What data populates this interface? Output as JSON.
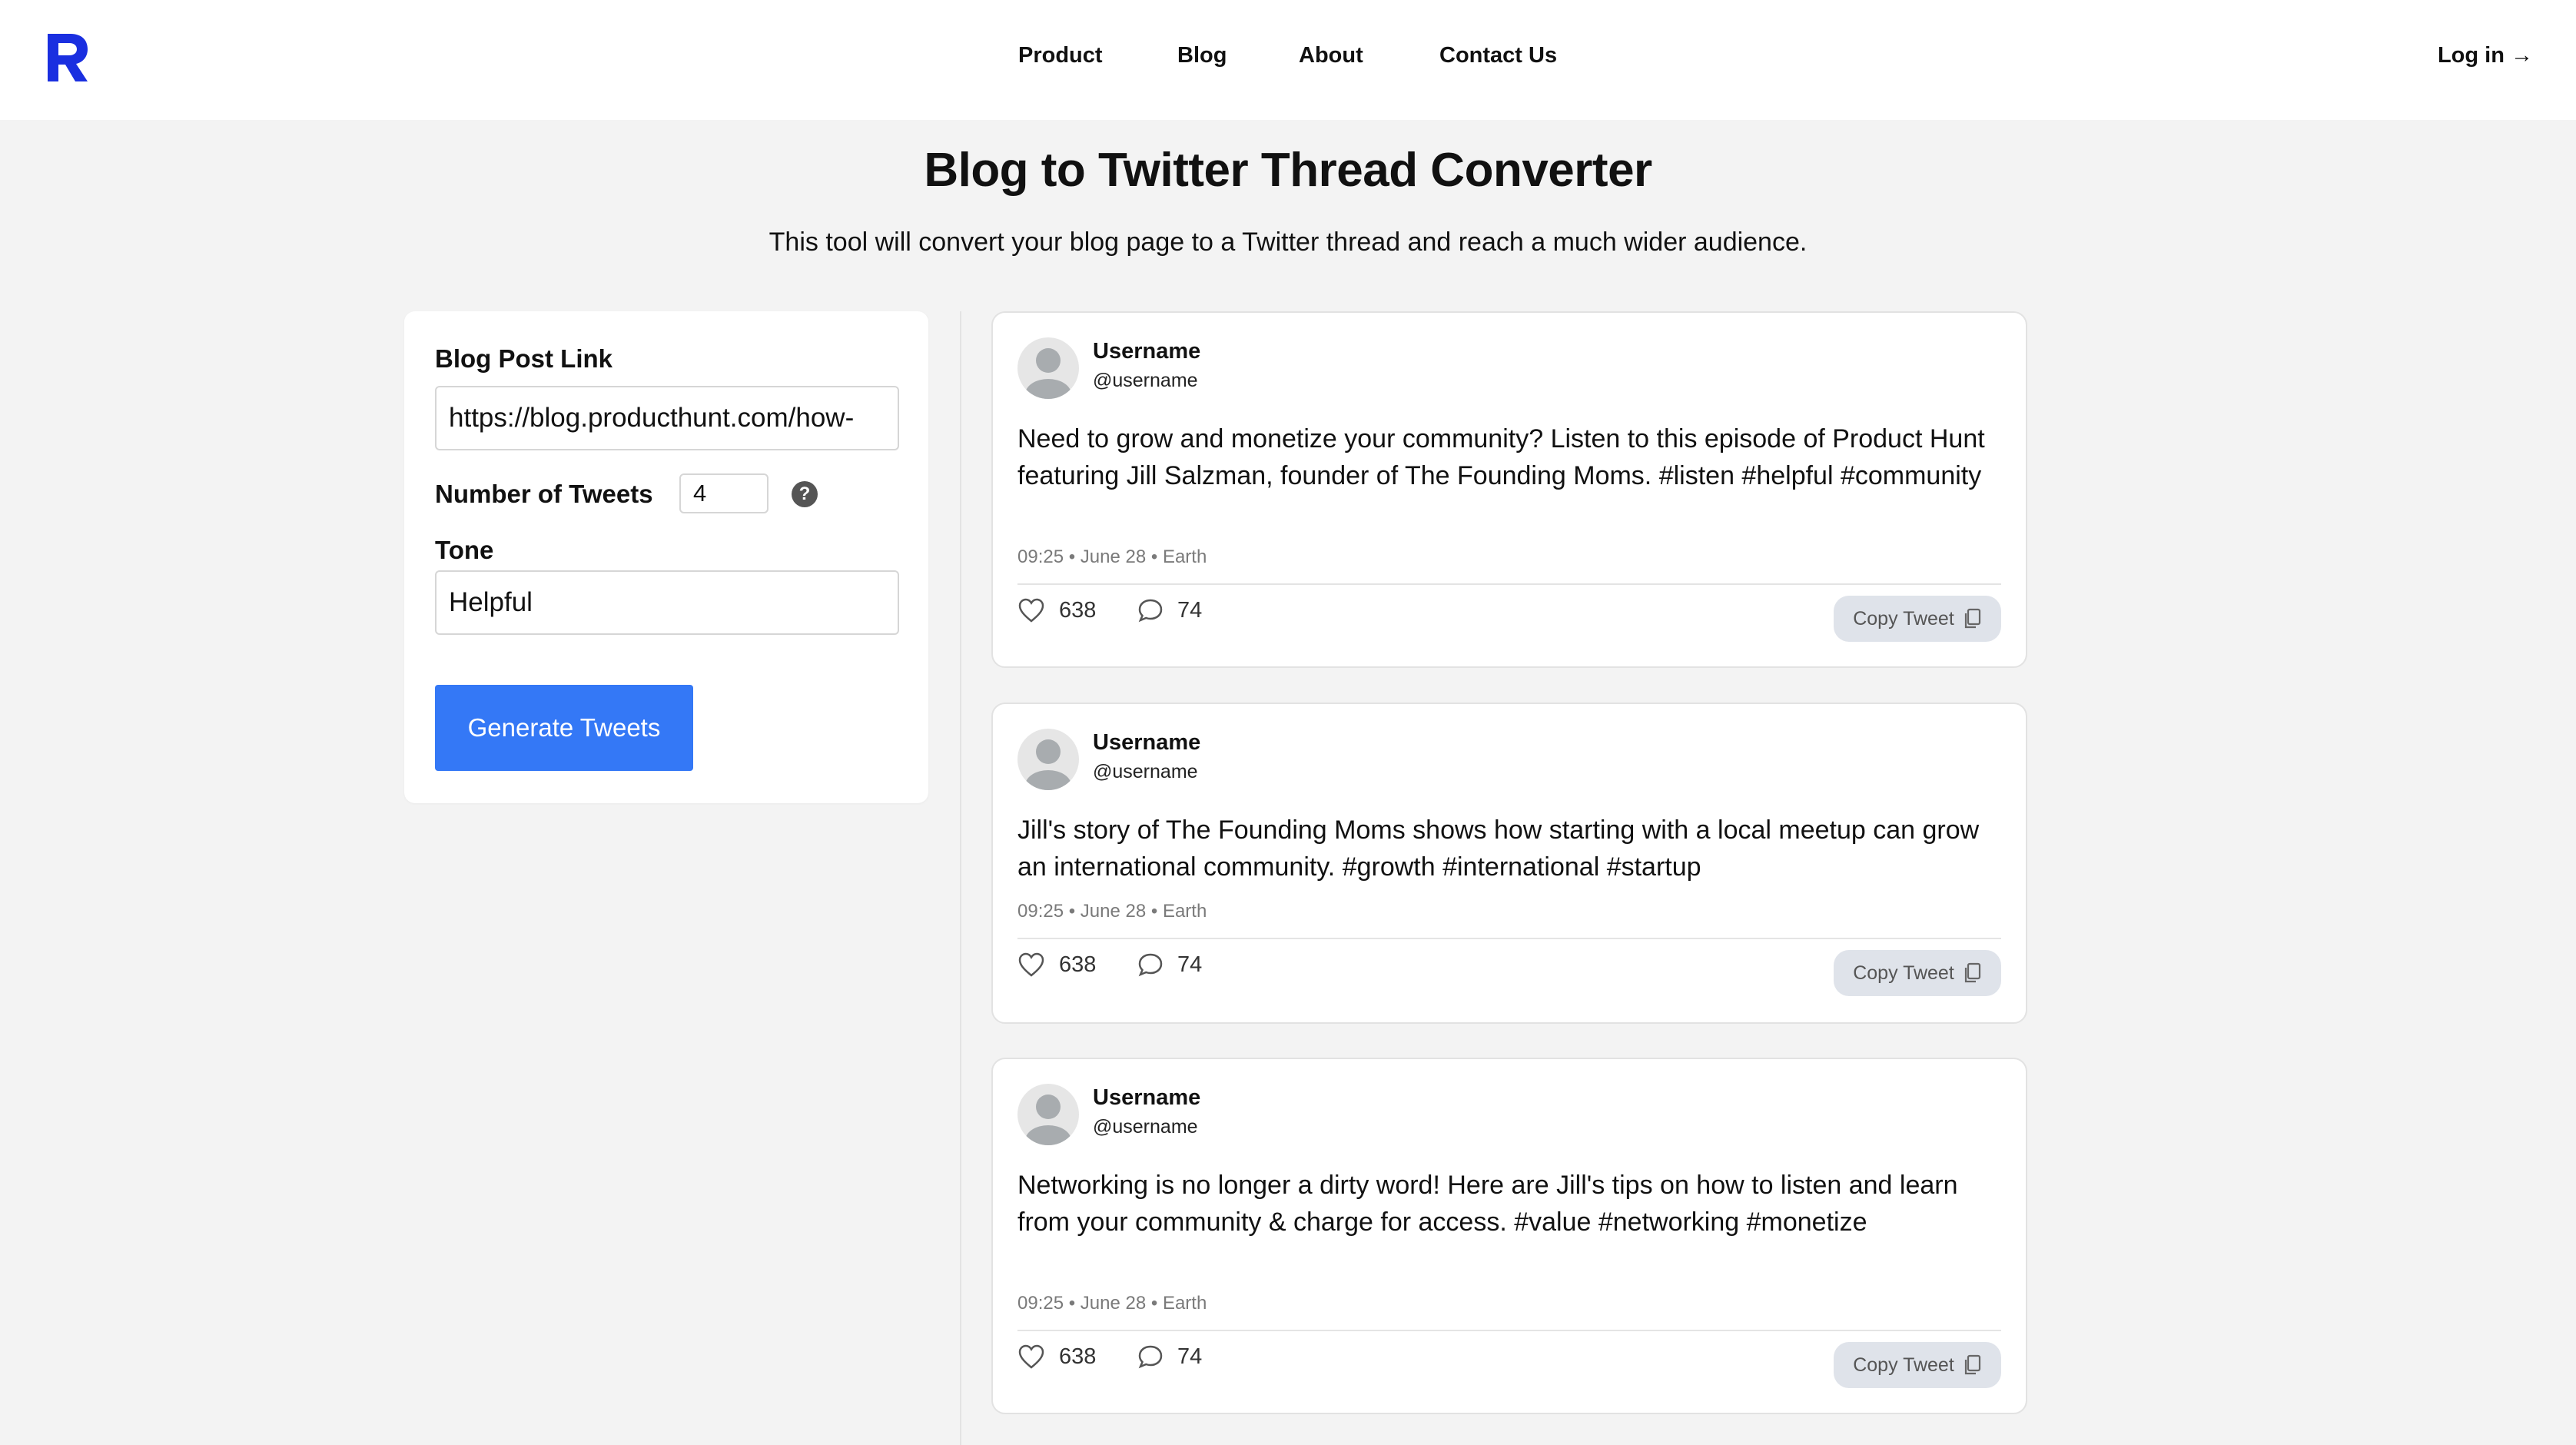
{
  "header": {
    "nav": [
      "Product",
      "Blog",
      "About",
      "Contact Us"
    ],
    "login_label": "Log in →"
  },
  "hero": {
    "title": "Blog to Twitter Thread Converter",
    "subtitle": "This tool will convert your blog page to a Twitter thread and reach a much wider audience."
  },
  "form": {
    "link_label": "Blog Post Link",
    "link_value": "https://blog.producthunt.com/how-",
    "count_label": "Number of Tweets",
    "count_value": "4",
    "help_icon": "?",
    "tone_label": "Tone",
    "tone_value": "Helpful",
    "generate_label": "Generate Tweets"
  },
  "tweets": [
    {
      "username": "Username",
      "handle": "@username",
      "text": "Need to grow and monetize your community? Listen to this episode of Product Hunt featuring Jill Salzman, founder of The Founding Moms. #listen #helpful #community",
      "meta": "09:25 • June 28 • Earth",
      "likes": "638",
      "comments": "74",
      "copy_label": "Copy Tweet"
    },
    {
      "username": "Username",
      "handle": "@username",
      "text": "Jill's story of The Founding Moms shows how starting with a local meetup can grow an international community. #growth #international #startup",
      "meta": "09:25 • June 28 • Earth",
      "likes": "638",
      "comments": "74",
      "copy_label": "Copy Tweet"
    },
    {
      "username": "Username",
      "handle": "@username",
      "text": "Networking is no longer a dirty word! Here are Jill's tips on how to listen and learn from your community & charge for access. #value #networking #monetize",
      "meta": "09:25 • June 28 • Earth",
      "likes": "638",
      "comments": "74",
      "copy_label": "Copy Tweet"
    }
  ],
  "colors": {
    "brand": "#1a2fe0",
    "primary_button": "#3478f6",
    "page_background": "#f3f3f3"
  }
}
